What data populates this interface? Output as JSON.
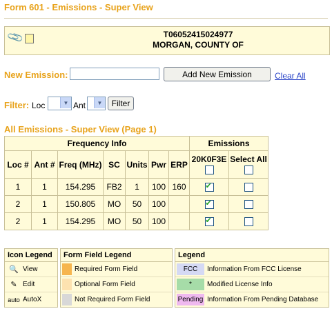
{
  "page_title": "Form 601 - Emissions - Super View",
  "header": {
    "call_sign": "T06052415024977",
    "licensee": "MORGAN, COUNTY OF",
    "icons": [
      "paperclip-icon",
      "note-icon"
    ]
  },
  "new_emission": {
    "label": "New Emission:",
    "value": "",
    "button": "Add New Emission",
    "clear_all": "Clear All"
  },
  "filter": {
    "label": "Filter:",
    "loc_label": "Loc",
    "loc_value": "",
    "ant_label": "Ant",
    "ant_value": "",
    "button": "Filter"
  },
  "section_title": "All Emissions - Super View (Page 1)",
  "table": {
    "group_frequency": "Frequency Info",
    "group_emissions": "Emissions",
    "columns": [
      "Loc #",
      "Ant #",
      "Freq (MHz)",
      "SC",
      "Units",
      "Pwr",
      "ERP"
    ],
    "emission_code": "20K0F3E",
    "select_all": "Select All",
    "rows": [
      {
        "loc": "1",
        "ant": "1",
        "freq": "154.295",
        "sc": "FB2",
        "units": "1",
        "pwr": "100",
        "erp": "160",
        "em_checked": true,
        "sel_checked": false
      },
      {
        "loc": "2",
        "ant": "1",
        "freq": "150.805",
        "sc": "MO",
        "units": "50",
        "pwr": "100",
        "erp": "",
        "em_checked": true,
        "sel_checked": false
      },
      {
        "loc": "2",
        "ant": "1",
        "freq": "154.295",
        "sc": "MO",
        "units": "50",
        "pwr": "100",
        "erp": "",
        "em_checked": true,
        "sel_checked": false
      }
    ]
  },
  "icon_legend": {
    "title": "Icon Legend",
    "items": [
      {
        "icon": "view-icon",
        "label": "View"
      },
      {
        "icon": "edit-icon",
        "label": "Edit"
      },
      {
        "icon": "auto-icon",
        "glyph": "auto",
        "label": "AutoX"
      }
    ]
  },
  "form_field_legend": {
    "title": "Form Field Legend",
    "items": [
      {
        "label": "Required Form Field",
        "color": "#f6b54e"
      },
      {
        "label": "Optional Form Field",
        "color": "#fde2b0"
      },
      {
        "label": "Not Required Form Field",
        "color": "#d8d8d8"
      }
    ]
  },
  "legend": {
    "title": "Legend",
    "items": [
      {
        "tag": "FCC",
        "label": "Information From FCC License",
        "color": "#d5d9f4"
      },
      {
        "tag": "*",
        "label": "Modified License Info",
        "color": "#a6dca8"
      },
      {
        "tag": "Pending",
        "label": "Information From Pending Database",
        "color": "#efb9ef"
      }
    ]
  },
  "colors": {
    "accent": "#e8a31c",
    "panel": "#fffbd9",
    "border": "#c8c098",
    "link": "#2c46c8"
  }
}
